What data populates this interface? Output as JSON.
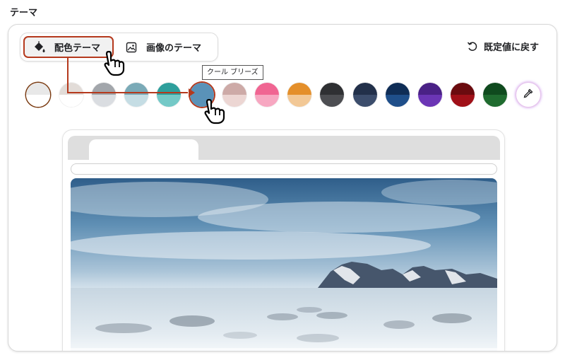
{
  "section": {
    "title": "テーマ"
  },
  "tabs": [
    {
      "label": "配色テーマ",
      "icon": "paint-bucket-icon",
      "active": true
    },
    {
      "label": "画像のテーマ",
      "icon": "image-icon",
      "active": false
    }
  ],
  "reset": {
    "label": "既定値に戻す",
    "icon": "undo-icon"
  },
  "tooltip": {
    "text": "クール ブリーズ"
  },
  "swatches": [
    {
      "top": "#e8e8e8",
      "bottom": "#ffffff"
    },
    {
      "top": "#e2dcd8",
      "bottom": "#ffffff"
    },
    {
      "top": "#a2a6ab",
      "bottom": "#dadde1"
    },
    {
      "top": "#7aaab7",
      "bottom": "#c5dde4"
    },
    {
      "top": "#2e9f9c",
      "bottom": "#74c9c7"
    },
    {
      "top": "#5a92b8",
      "bottom": "#5a92b8"
    },
    {
      "top": "#cdaaa7",
      "bottom": "#ecd6d3"
    },
    {
      "top": "#f06592",
      "bottom": "#f7a7c1"
    },
    {
      "top": "#e48f2a",
      "bottom": "#f2c896"
    },
    {
      "top": "#2f3033",
      "bottom": "#4d4e52"
    },
    {
      "top": "#22304a",
      "bottom": "#3c4d6c"
    },
    {
      "top": "#0f2d56",
      "bottom": "#1f4f8a"
    },
    {
      "top": "#4a2186",
      "bottom": "#6b35b5"
    },
    {
      "top": "#6b0b0f",
      "bottom": "#a01018"
    },
    {
      "top": "#0f4a1e",
      "bottom": "#1f6b2f"
    }
  ],
  "eyedropper": {
    "icon": "eyedropper-icon"
  },
  "colors": {
    "accent": "#b5391d",
    "tab_strip": "#dedede"
  }
}
